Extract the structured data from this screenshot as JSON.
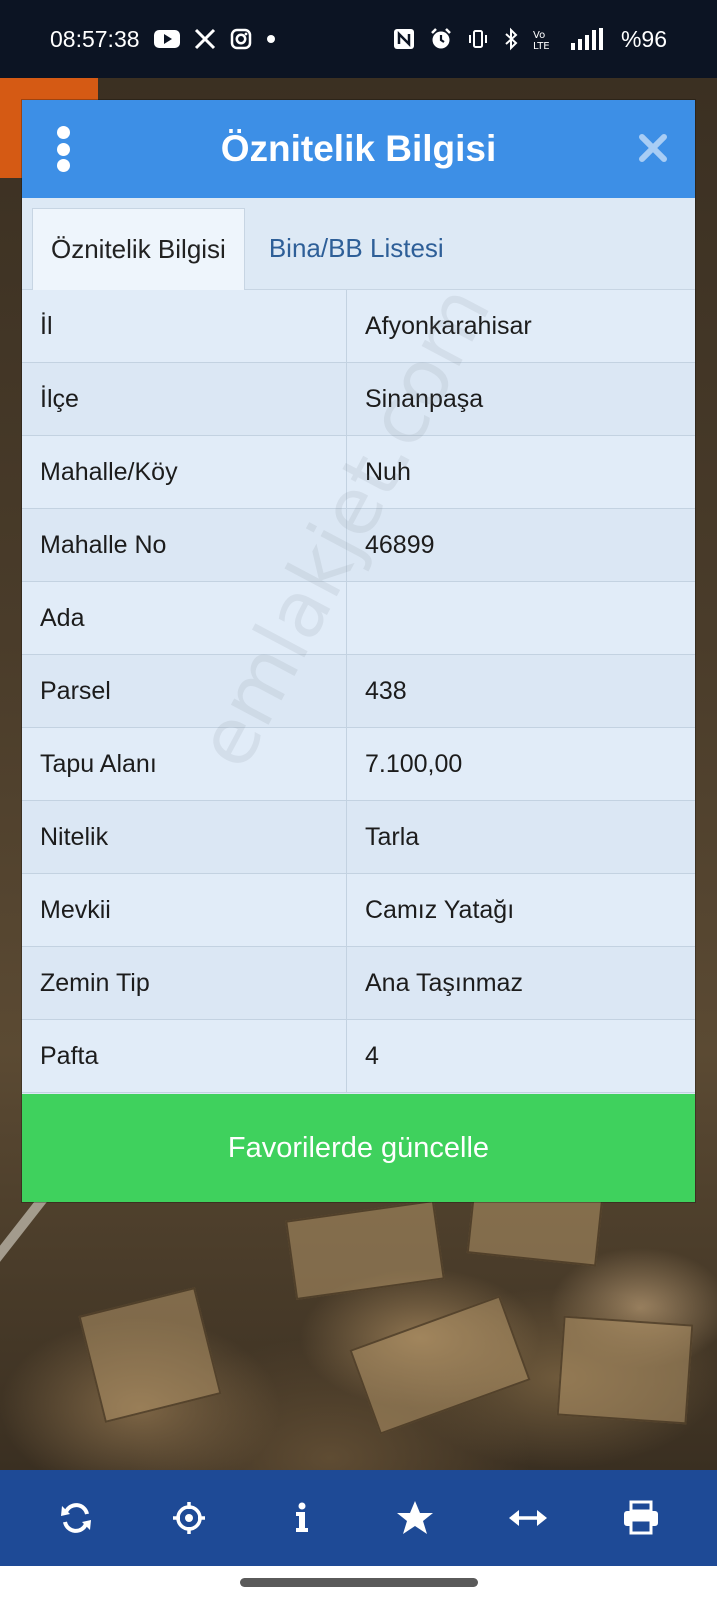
{
  "status_bar": {
    "time": "08:57:38",
    "battery": "%96",
    "left_icons": [
      "youtube-icon",
      "x-icon",
      "instagram-icon",
      "dot-icon"
    ],
    "right_icons": [
      "nfc-icon",
      "alarm-icon",
      "vibrate-icon",
      "bluetooth-icon",
      "volte-icon",
      "signal-icon"
    ]
  },
  "dialog": {
    "title": "Öznitelik Bilgisi",
    "tabs": [
      {
        "label": "Öznitelik Bilgisi",
        "active": true
      },
      {
        "label": "Bina/BB Listesi",
        "active": false
      }
    ],
    "rows": [
      {
        "key": "İl",
        "value": "Afyonkarahisar"
      },
      {
        "key": "İlçe",
        "value": "Sinanpaşa"
      },
      {
        "key": "Mahalle/Köy",
        "value": "Nuh"
      },
      {
        "key": "Mahalle No",
        "value": "46899"
      },
      {
        "key": "Ada",
        "value": ""
      },
      {
        "key": "Parsel",
        "value": "438"
      },
      {
        "key": "Tapu Alanı",
        "value": "7.100,00"
      },
      {
        "key": "Nitelik",
        "value": "Tarla"
      },
      {
        "key": "Mevkii",
        "value": "Camız Yatağı"
      },
      {
        "key": "Zemin Tip",
        "value": "Ana Taşınmaz"
      },
      {
        "key": "Pafta",
        "value": "4"
      }
    ],
    "action_label": "Favorilerde güncelle"
  },
  "toolbar": {
    "buttons": [
      "refresh-icon",
      "locate-icon",
      "info-icon",
      "star-icon",
      "measure-icon",
      "print-icon"
    ]
  },
  "watermark": "emlakjet.com",
  "colors": {
    "header": "#3d8fe6",
    "action": "#3fd15d",
    "toolbar": "#1e4a96",
    "status_bar": "#0c1423"
  }
}
